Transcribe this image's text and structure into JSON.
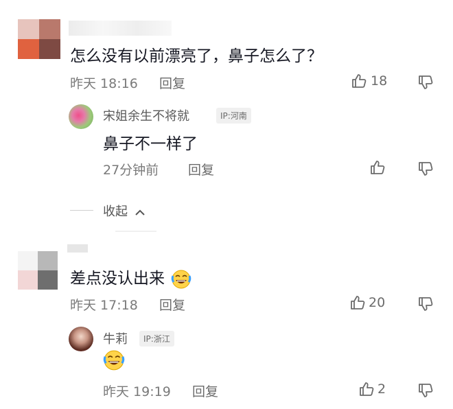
{
  "comments": [
    {
      "text": "怎么没有以前漂亮了，鼻子怎么了？",
      "time": "昨天 18:16",
      "reply_label": "回复",
      "likes": "18",
      "replies": [
        {
          "name": "宋姐余生不将就",
          "ip": "IP:河南",
          "text": "鼻子不一样了",
          "time": "27分钟前",
          "reply_label": "回复"
        }
      ],
      "collapse_label": "收起"
    },
    {
      "text": "差点没认出来",
      "time": "昨天 17:18",
      "reply_label": "回复",
      "likes": "20",
      "replies": [
        {
          "name": "牛莉",
          "ip": "IP:浙江",
          "time": "昨天 19:19",
          "reply_label": "回复",
          "likes": "2"
        }
      ]
    }
  ],
  "colors": {
    "text": "#161823",
    "meta": "#7a7a7a",
    "badge_bg": "#f0f0f0"
  },
  "icons": [
    "thumb-up-icon",
    "thumb-down-icon",
    "chevron-up-icon",
    "laughing-emoji-icon"
  ]
}
